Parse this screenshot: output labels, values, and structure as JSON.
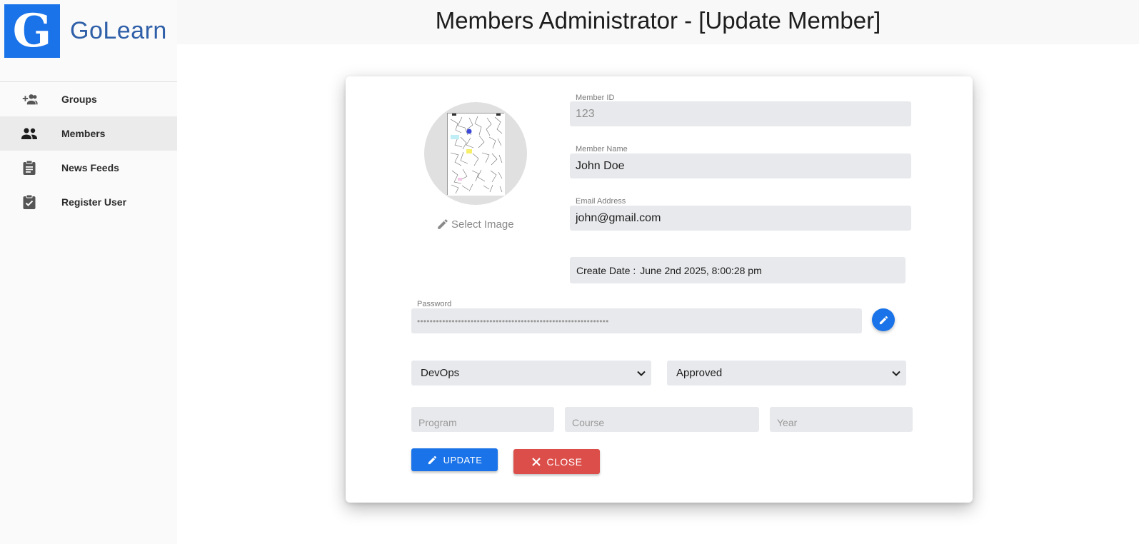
{
  "brand": {
    "logo_letter": "G",
    "name": "GoLearn",
    "primary_color": "#1a73e8",
    "danger_color": "#dc4e4a"
  },
  "sidebar": {
    "items": [
      {
        "label": "Groups",
        "icon": "group-add-icon",
        "active": false
      },
      {
        "label": "Members",
        "icon": "people-icon",
        "active": true
      },
      {
        "label": "News Feeds",
        "icon": "clipboard-icon",
        "active": false
      },
      {
        "label": "Register User",
        "icon": "clipboard-check-icon",
        "active": false
      }
    ]
  },
  "header": {
    "title": "Members Administrator - [Update Member]"
  },
  "form": {
    "avatar": {
      "select_label": "Select Image",
      "icon": "pencil-icon"
    },
    "member_id": {
      "label": "Member ID",
      "value": "123"
    },
    "member_name": {
      "label": "Member Name",
      "value": "John Doe"
    },
    "email": {
      "label": "Email Address",
      "value": "john@gmail.com"
    },
    "create_date": {
      "label": "Create Date :",
      "value": "June 2nd 2025, 8:00:28 pm"
    },
    "password": {
      "label": "Password",
      "value": "•••••••••••••••••••••••••••••••••••••••••••••••••••••••••••••"
    },
    "group_select": {
      "value": "DevOps"
    },
    "status_select": {
      "value": "Approved"
    },
    "program": {
      "placeholder": "Program"
    },
    "course": {
      "placeholder": "Course"
    },
    "year": {
      "placeholder": "Year"
    },
    "buttons": {
      "update": "UPDATE",
      "close": "CLOSE"
    }
  }
}
